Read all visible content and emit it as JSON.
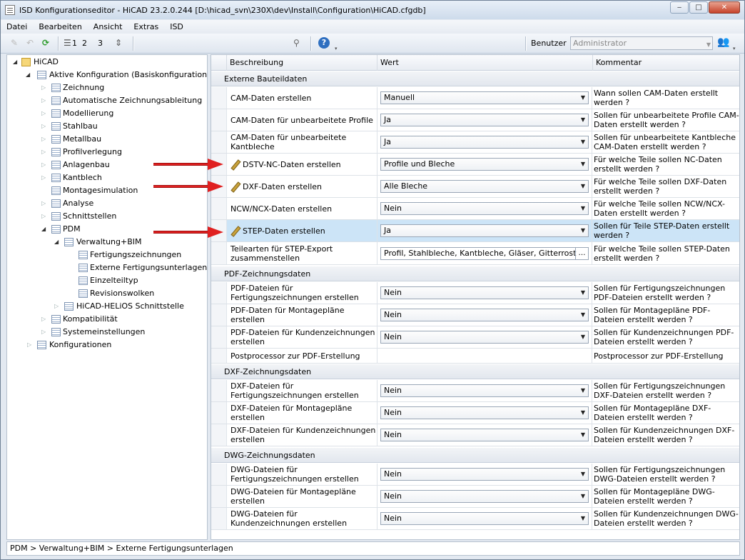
{
  "window": {
    "title": "ISD Konfigurationseditor - HiCAD 23.2.0.244 [D:\\hicad_svn\\230X\\dev\\Install\\Configuration\\HiCAD.cfgdb]",
    "min": "‒",
    "max": "□",
    "close": "✕"
  },
  "menu": [
    "Datei",
    "Bearbeiten",
    "Ansicht",
    "Extras",
    "ISD"
  ],
  "toolbar": {
    "user_label": "Benutzer",
    "user_value": "Administrator",
    "b1": "1",
    "b2": "2",
    "b3": "3"
  },
  "tree": {
    "root": "HiCAD",
    "active": "Aktive Konfiguration (Basiskonfiguration)",
    "items": [
      "Zeichnung",
      "Automatische Zeichnungsableitung",
      "Modellierung",
      "Stahlbau",
      "Metallbau",
      "Profilverlegung",
      "Anlagenbau",
      "Kantblech",
      "Montagesimulation",
      "Analyse",
      "Schnittstellen",
      "PDM"
    ],
    "pdm_child": "Verwaltung+BIM",
    "bim_children": [
      "Fertigungszeichnungen",
      "Externe Fertigungsunterlagen",
      "Einzelteiltyp",
      "Revisionswolken"
    ],
    "helios": "HiCAD-HELiOS Schnittstelle",
    "kompat": "Kompatibilität",
    "system": "Systemeinstellungen",
    "konfig": "Konfigurationen"
  },
  "grid": {
    "headers": [
      "Beschreibung",
      "Wert",
      "Kommentar"
    ],
    "sections": [
      {
        "title": "Externe Bauteildaten",
        "rows": [
          {
            "desc": "CAM-Daten erstellen",
            "value": "Manuell",
            "comment": "Wann sollen CAM-Daten erstellt werden ?"
          },
          {
            "desc": "CAM-Daten für unbearbeitete Profile",
            "value": "Ja",
            "comment": "Sollen für unbearbeitete Profile CAM-Daten erstellt werden ?"
          },
          {
            "desc": "CAM-Daten für unbearbeitete Kantbleche",
            "value": "Ja",
            "comment": "Sollen für unbearbeitete Kantbleche CAM-Daten erstellt werden ?"
          },
          {
            "desc": "DSTV-NC-Daten erstellen",
            "value": "Profile und Bleche",
            "comment": "Für welche Teile sollen NC-Daten erstellt werden ?"
          },
          {
            "desc": "DXF-Daten erstellen",
            "value": "Alle Bleche",
            "comment": "Für welche Teile sollen DXF-Daten erstellt werden ?"
          },
          {
            "desc": "NCW/NCX-Daten erstellen",
            "value": "Nein",
            "comment": "Für welche Teile sollen NCW/NCX-Daten erstellt werden ?"
          },
          {
            "desc": "STEP-Daten erstellen",
            "value": "Ja",
            "comment": "Sollen für Teile STEP-Daten erstellt werden ?"
          },
          {
            "desc": "Teilearten für STEP-Export zusammenstellen",
            "value": "Profil, Stahlbleche, Kantbleche, Gläser, Gitterrost",
            "comment": "Für welche Teile sollen STEP-Daten erstellt werden ?"
          }
        ]
      },
      {
        "title": "PDF-Zeichnungsdaten",
        "rows": [
          {
            "desc": "PDF-Dateien für Fertigungszeichnungen erstellen",
            "value": "Nein",
            "comment": "Sollen für Fertigungszeichnungen PDF-Dateien erstellt werden ?"
          },
          {
            "desc": "PDF-Daten für Montagepläne erstellen",
            "value": "Nein",
            "comment": "Sollen für Montagepläne PDF-Dateien erstellt werden ?"
          },
          {
            "desc": "PDF-Dateien für Kundenzeichnungen erstellen",
            "value": "Nein",
            "comment": "Sollen für Kundenzeichnungen PDF-Dateien erstellt werden ?"
          },
          {
            "desc": "Postprocessor zur PDF-Erstellung",
            "value": "",
            "comment": "Postprocessor zur PDF-Erstellung"
          }
        ]
      },
      {
        "title": "DXF-Zeichnungsdaten",
        "rows": [
          {
            "desc": "DXF-Dateien für Fertigungszeichnungen erstellen",
            "value": "Nein",
            "comment": "Sollen für Fertigungszeichnungen DXF-Dateien erstellt werden ?"
          },
          {
            "desc": "DXF-Dateien für Montagepläne erstellen",
            "value": "Nein",
            "comment": "Sollen für Montagepläne DXF-Dateien erstellt werden ?"
          },
          {
            "desc": "DXF-Dateien für Kundenzeichnungen erstellen",
            "value": "Nein",
            "comment": "Sollen für Kundenzeichnungen DXF-Dateien erstellt werden ?"
          }
        ]
      },
      {
        "title": "DWG-Zeichnungsdaten",
        "rows": [
          {
            "desc": "DWG-Dateien für Fertigungszeichnungen erstellen",
            "value": "Nein",
            "comment": "Sollen für Fertigungszeichnungen DWG-Dateien erstellt werden ?"
          },
          {
            "desc": "DWG-Dateien für Montagepläne erstellen",
            "value": "Nein",
            "comment": "Sollen für Montagepläne DWG-Dateien erstellt werden ?"
          },
          {
            "desc": "DWG-Dateien für Kundenzeichnungen erstellen",
            "value": "Nein",
            "comment": "Sollen für Kundenzeichnungen DWG-Dateien erstellt werden ?"
          }
        ]
      }
    ]
  },
  "status": "PDM > Verwaltung+BIM > Externe Fertigungsunterlagen",
  "colors": {
    "selected_row": "#cce4f7",
    "arrow": "#e02020"
  }
}
